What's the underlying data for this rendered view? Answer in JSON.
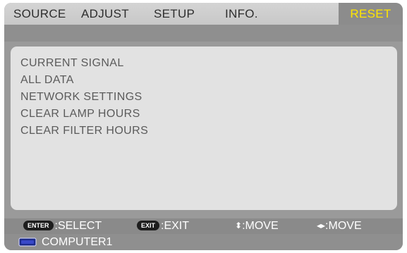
{
  "tabs": [
    {
      "label": "SOURCE"
    },
    {
      "label": "ADJUST"
    },
    {
      "label": "SETUP"
    },
    {
      "label": "INFO."
    },
    {
      "label": "RESET",
      "selected": true
    }
  ],
  "reset_menu": {
    "items": [
      {
        "label": "CURRENT SIGNAL"
      },
      {
        "label": "ALL DATA"
      },
      {
        "label": "NETWORK SETTINGS"
      },
      {
        "label": "CLEAR LAMP HOURS"
      },
      {
        "label": "CLEAR FILTER HOURS"
      }
    ]
  },
  "help": {
    "enter_key": "ENTER",
    "enter_text": ":SELECT",
    "exit_key": "EXIT",
    "exit_text": ":EXIT",
    "updown_glyph": "⬍",
    "updown_text": ":MOVE",
    "leftright_glyph": "◂▸",
    "leftright_text": ":MOVE"
  },
  "status": {
    "input_icon": "monitor-connector-icon",
    "input_label": "COMPUTER1"
  },
  "colors": {
    "selected_tab_text": "#ffe600",
    "selected_tab_bg": "#8c8c8c",
    "panel_bg": "#e2e2e2",
    "menu_text": "#5b5b5b"
  }
}
